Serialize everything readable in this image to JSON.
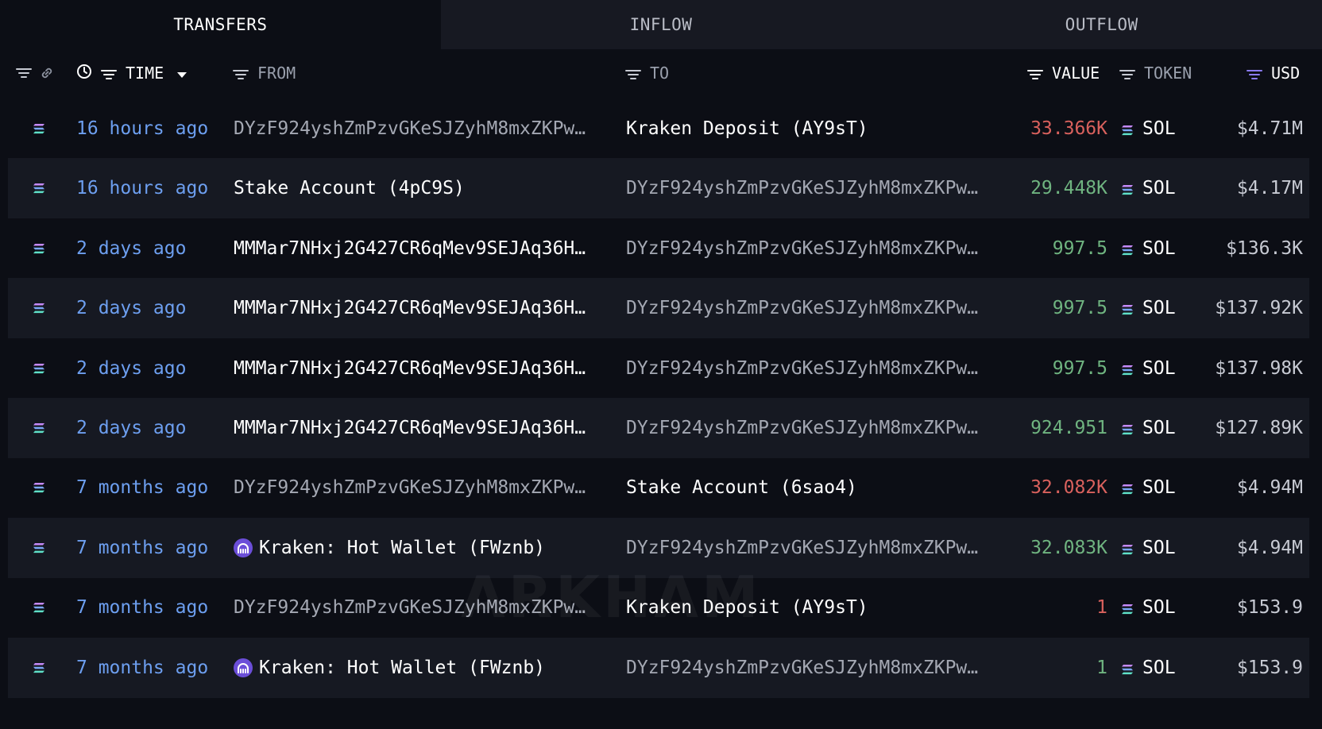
{
  "tabs": [
    {
      "label": "TRANSFERS",
      "active": true
    },
    {
      "label": "INFLOW",
      "active": false
    },
    {
      "label": "OUTFLOW",
      "active": false
    }
  ],
  "columns": {
    "time": "TIME",
    "from": "FROM",
    "to": "TO",
    "value": "VALUE",
    "token": "TOKEN",
    "usd": "USD"
  },
  "colors": {
    "accent_time": "#6d9ff0",
    "outflow": "#d9615d",
    "inflow": "#6fb480",
    "usd_filter_active": "#8b7cf6"
  },
  "watermark": "ARKHAM",
  "rows": [
    {
      "time": "16 hours ago",
      "from": "DYzF924yshZmPzvGKeSJZyhM8mxZKPw…",
      "from_named": false,
      "from_icon": "",
      "to": "Kraken Deposit (AY9sT)",
      "to_named": true,
      "value": "33.366K",
      "direction": "out",
      "token": "SOL",
      "usd": "$4.71M"
    },
    {
      "time": "16 hours ago",
      "from": "Stake Account (4pC9S)",
      "from_named": true,
      "from_icon": "",
      "to": "DYzF924yshZmPzvGKeSJZyhM8mxZKPw…",
      "to_named": false,
      "value": "29.448K",
      "direction": "in",
      "token": "SOL",
      "usd": "$4.17M"
    },
    {
      "time": "2 days ago",
      "from": "MMMar7NHxj2G427CR6qMev9SEJAq36H…",
      "from_named": true,
      "from_icon": "",
      "to": "DYzF924yshZmPzvGKeSJZyhM8mxZKPw…",
      "to_named": false,
      "value": "997.5",
      "direction": "in",
      "token": "SOL",
      "usd": "$136.3K"
    },
    {
      "time": "2 days ago",
      "from": "MMMar7NHxj2G427CR6qMev9SEJAq36H…",
      "from_named": true,
      "from_icon": "",
      "to": "DYzF924yshZmPzvGKeSJZyhM8mxZKPw…",
      "to_named": false,
      "value": "997.5",
      "direction": "in",
      "token": "SOL",
      "usd": "$137.92K"
    },
    {
      "time": "2 days ago",
      "from": "MMMar7NHxj2G427CR6qMev9SEJAq36H…",
      "from_named": true,
      "from_icon": "",
      "to": "DYzF924yshZmPzvGKeSJZyhM8mxZKPw…",
      "to_named": false,
      "value": "997.5",
      "direction": "in",
      "token": "SOL",
      "usd": "$137.98K"
    },
    {
      "time": "2 days ago",
      "from": "MMMar7NHxj2G427CR6qMev9SEJAq36H…",
      "from_named": true,
      "from_icon": "",
      "to": "DYzF924yshZmPzvGKeSJZyhM8mxZKPw…",
      "to_named": false,
      "value": "924.951",
      "direction": "in",
      "token": "SOL",
      "usd": "$127.89K"
    },
    {
      "time": "7 months ago",
      "from": "DYzF924yshZmPzvGKeSJZyhM8mxZKPw…",
      "from_named": false,
      "from_icon": "",
      "to": "Stake Account (6sao4)",
      "to_named": true,
      "value": "32.082K",
      "direction": "out",
      "token": "SOL",
      "usd": "$4.94M"
    },
    {
      "time": "7 months ago",
      "from": "Kraken: Hot Wallet (FWznb)",
      "from_named": true,
      "from_icon": "kraken-icon",
      "to": "DYzF924yshZmPzvGKeSJZyhM8mxZKPw…",
      "to_named": false,
      "value": "32.083K",
      "direction": "in",
      "token": "SOL",
      "usd": "$4.94M"
    },
    {
      "time": "7 months ago",
      "from": "DYzF924yshZmPzvGKeSJZyhM8mxZKPw…",
      "from_named": false,
      "from_icon": "",
      "to": "Kraken Deposit (AY9sT)",
      "to_named": true,
      "value": "1",
      "direction": "out",
      "token": "SOL",
      "usd": "$153.9"
    },
    {
      "time": "7 months ago",
      "from": "Kraken: Hot Wallet (FWznb)",
      "from_named": true,
      "from_icon": "kraken-icon",
      "to": "DYzF924yshZmPzvGKeSJZyhM8mxZKPw…",
      "to_named": false,
      "value": "1",
      "direction": "in",
      "token": "SOL",
      "usd": "$153.9"
    }
  ]
}
